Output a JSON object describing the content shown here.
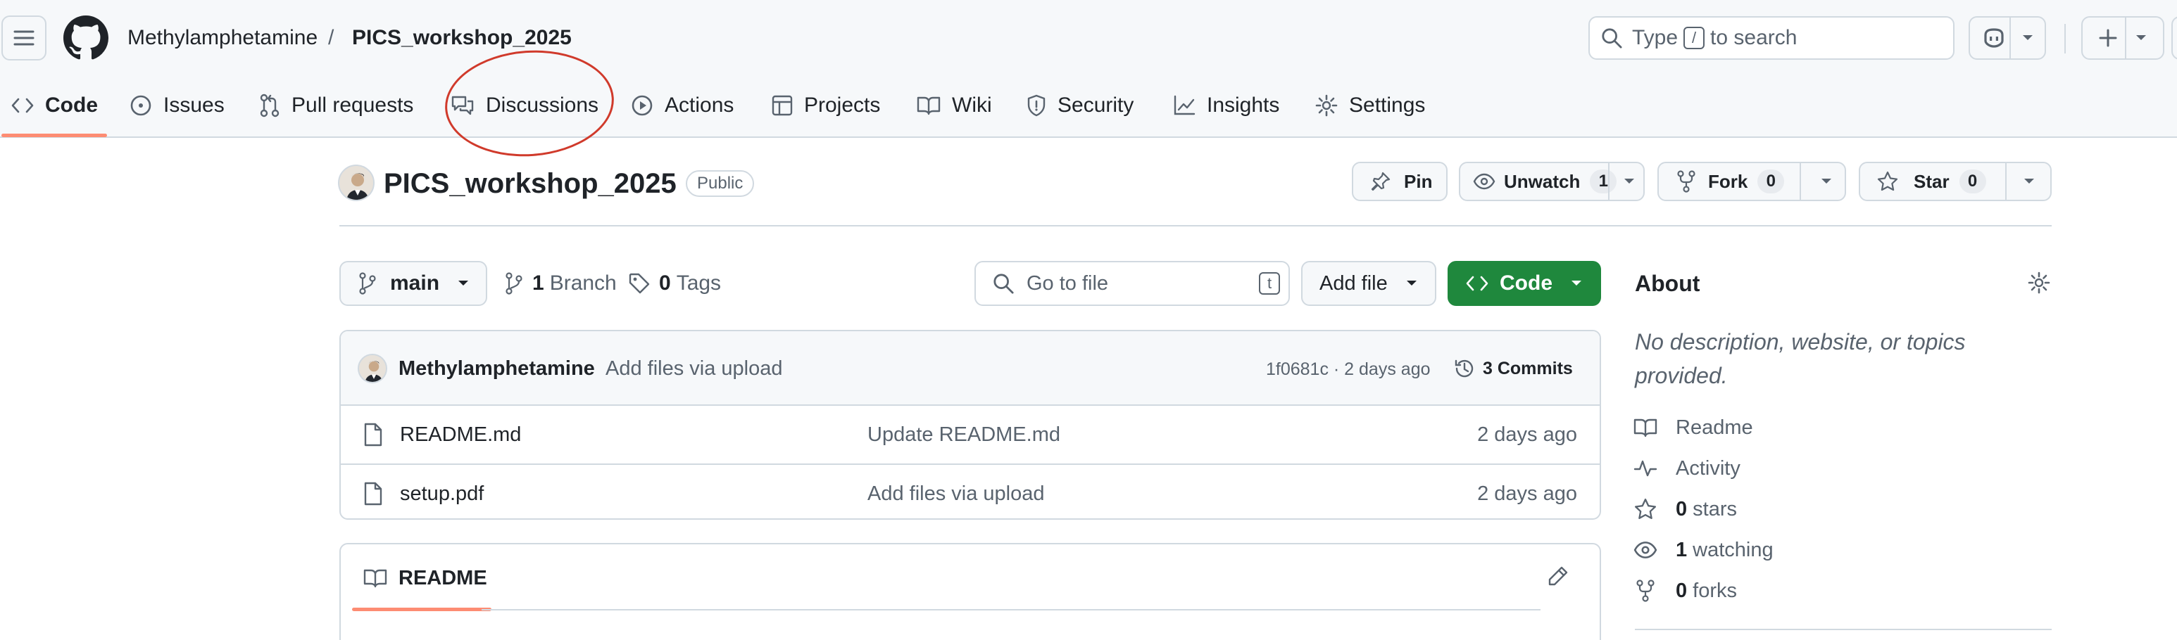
{
  "header": {
    "owner": "Methylamphetamine",
    "separator": "/",
    "repo": "PICS_workshop_2025",
    "search": {
      "before": "Type",
      "key": "/",
      "after": "to search"
    }
  },
  "nav": {
    "tabs": [
      {
        "label": "Code",
        "icon": "code-icon",
        "active": true
      },
      {
        "label": "Issues",
        "icon": "issue-icon"
      },
      {
        "label": "Pull requests",
        "icon": "pull-request-icon"
      },
      {
        "label": "Discussions",
        "icon": "discussion-icon",
        "highlighted": true
      },
      {
        "label": "Actions",
        "icon": "play-icon"
      },
      {
        "label": "Projects",
        "icon": "table-icon"
      },
      {
        "label": "Wiki",
        "icon": "book-icon"
      },
      {
        "label": "Security",
        "icon": "shield-icon"
      },
      {
        "label": "Insights",
        "icon": "graph-icon"
      },
      {
        "label": "Settings",
        "icon": "gear-icon"
      }
    ]
  },
  "repo": {
    "name": "PICS_workshop_2025",
    "visibility": "Public",
    "pin_label": "Pin",
    "unwatch_label": "Unwatch",
    "watch_count": "1",
    "fork_label": "Fork",
    "fork_count": "0",
    "star_label": "Star",
    "star_count": "0"
  },
  "toolbar": {
    "branch": "main",
    "branch_count": "1",
    "branch_label": "Branch",
    "tag_count": "0",
    "tag_label": "Tags",
    "go_to_file_placeholder": "Go to file",
    "go_to_file_key": "t",
    "add_file_label": "Add file",
    "code_label": "Code"
  },
  "commit": {
    "author": "Methylamphetamine",
    "message": "Add files via upload",
    "meta": "1f0681c · 2 days ago",
    "commits_label": "3 Commits"
  },
  "files": [
    {
      "name": "README.md",
      "message": "Update README.md",
      "age": "2 days ago"
    },
    {
      "name": "setup.pdf",
      "message": "Add files via upload",
      "age": "2 days ago"
    }
  ],
  "readme": {
    "tab_label": "README"
  },
  "about": {
    "title": "About",
    "description": "No description, website, or topics provided.",
    "readme_label": "Readme",
    "activity_label": "Activity",
    "stars_count": "0",
    "stars_label": "stars",
    "watching_count": "1",
    "watching_label": "watching",
    "forks_count": "0",
    "forks_label": "forks"
  },
  "colors": {
    "accent_orange": "#fd8c73",
    "code_button_green": "#1f883d",
    "annotation_red": "#d03a2b",
    "link_blue": "#0969da"
  }
}
